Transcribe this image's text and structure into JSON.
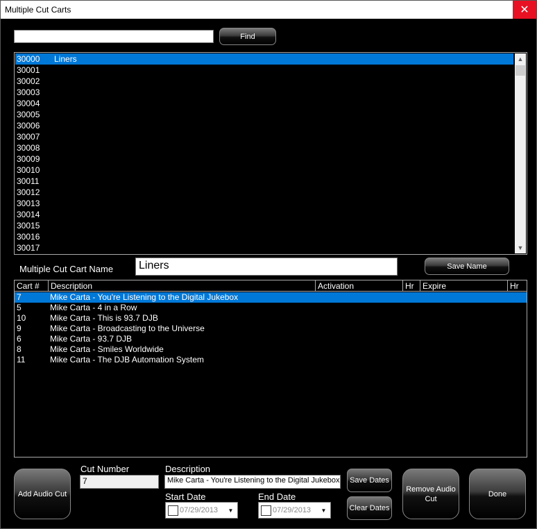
{
  "window": {
    "title": "Multiple Cut Carts"
  },
  "search": {
    "value": "",
    "find_label": "Find"
  },
  "cart_list": {
    "items": [
      {
        "number": "30000",
        "name": "Liners",
        "selected": true
      },
      {
        "number": "30001",
        "name": ""
      },
      {
        "number": "30002",
        "name": ""
      },
      {
        "number": "30003",
        "name": ""
      },
      {
        "number": "30004",
        "name": ""
      },
      {
        "number": "30005",
        "name": ""
      },
      {
        "number": "30006",
        "name": ""
      },
      {
        "number": "30007",
        "name": ""
      },
      {
        "number": "30008",
        "name": ""
      },
      {
        "number": "30009",
        "name": ""
      },
      {
        "number": "30010",
        "name": ""
      },
      {
        "number": "30011",
        "name": ""
      },
      {
        "number": "30012",
        "name": ""
      },
      {
        "number": "30013",
        "name": ""
      },
      {
        "number": "30014",
        "name": ""
      },
      {
        "number": "30015",
        "name": ""
      },
      {
        "number": "30016",
        "name": ""
      },
      {
        "number": "30017",
        "name": ""
      }
    ]
  },
  "cart_name": {
    "label": "Multiple Cut Cart Name",
    "value": "Liners",
    "save_label": "Save Name"
  },
  "cuts_table": {
    "headers": {
      "cart": "Cart #",
      "description": "Description",
      "activation": "Activation",
      "hr1": "Hr",
      "expire": "Expire",
      "hr2": "Hr"
    },
    "rows": [
      {
        "cart": "7",
        "description": "Mike Carta - You're Listening to the Digital Jukebox",
        "selected": true
      },
      {
        "cart": "5",
        "description": "Mike Carta - 4 in a Row"
      },
      {
        "cart": "10",
        "description": "Mike Carta - This is 93.7 DJB"
      },
      {
        "cart": "9",
        "description": "Mike Carta - Broadcasting to the Universe"
      },
      {
        "cart": "6",
        "description": "Mike Carta - 93.7 DJB"
      },
      {
        "cart": "8",
        "description": "Mike Carta - Smiles Worldwide"
      },
      {
        "cart": "11",
        "description": "Mike Carta - The DJB Automation System"
      }
    ]
  },
  "editor": {
    "add_label": "Add Audio Cut",
    "cut_number_label": "Cut Number",
    "cut_number_value": "7",
    "description_label": "Description",
    "description_value": "Mike Carta - You're Listening to the Digital Jukebox",
    "save_dates_label": "Save Dates",
    "clear_dates_label": "Clear Dates",
    "start_date_label": "Start Date",
    "start_date_value": "07/29/2013",
    "end_date_label": "End Date",
    "end_date_value": "07/29/2013",
    "remove_label": "Remove Audio Cut",
    "done_label": "Done"
  },
  "colors": {
    "selection": "#0078d7",
    "close": "#e81123",
    "background": "#000000"
  },
  "icons": {
    "close": "close-icon",
    "scroll_up": "chevron-up-icon",
    "scroll_down": "chevron-down-icon",
    "dropdown": "chevron-down-icon"
  }
}
